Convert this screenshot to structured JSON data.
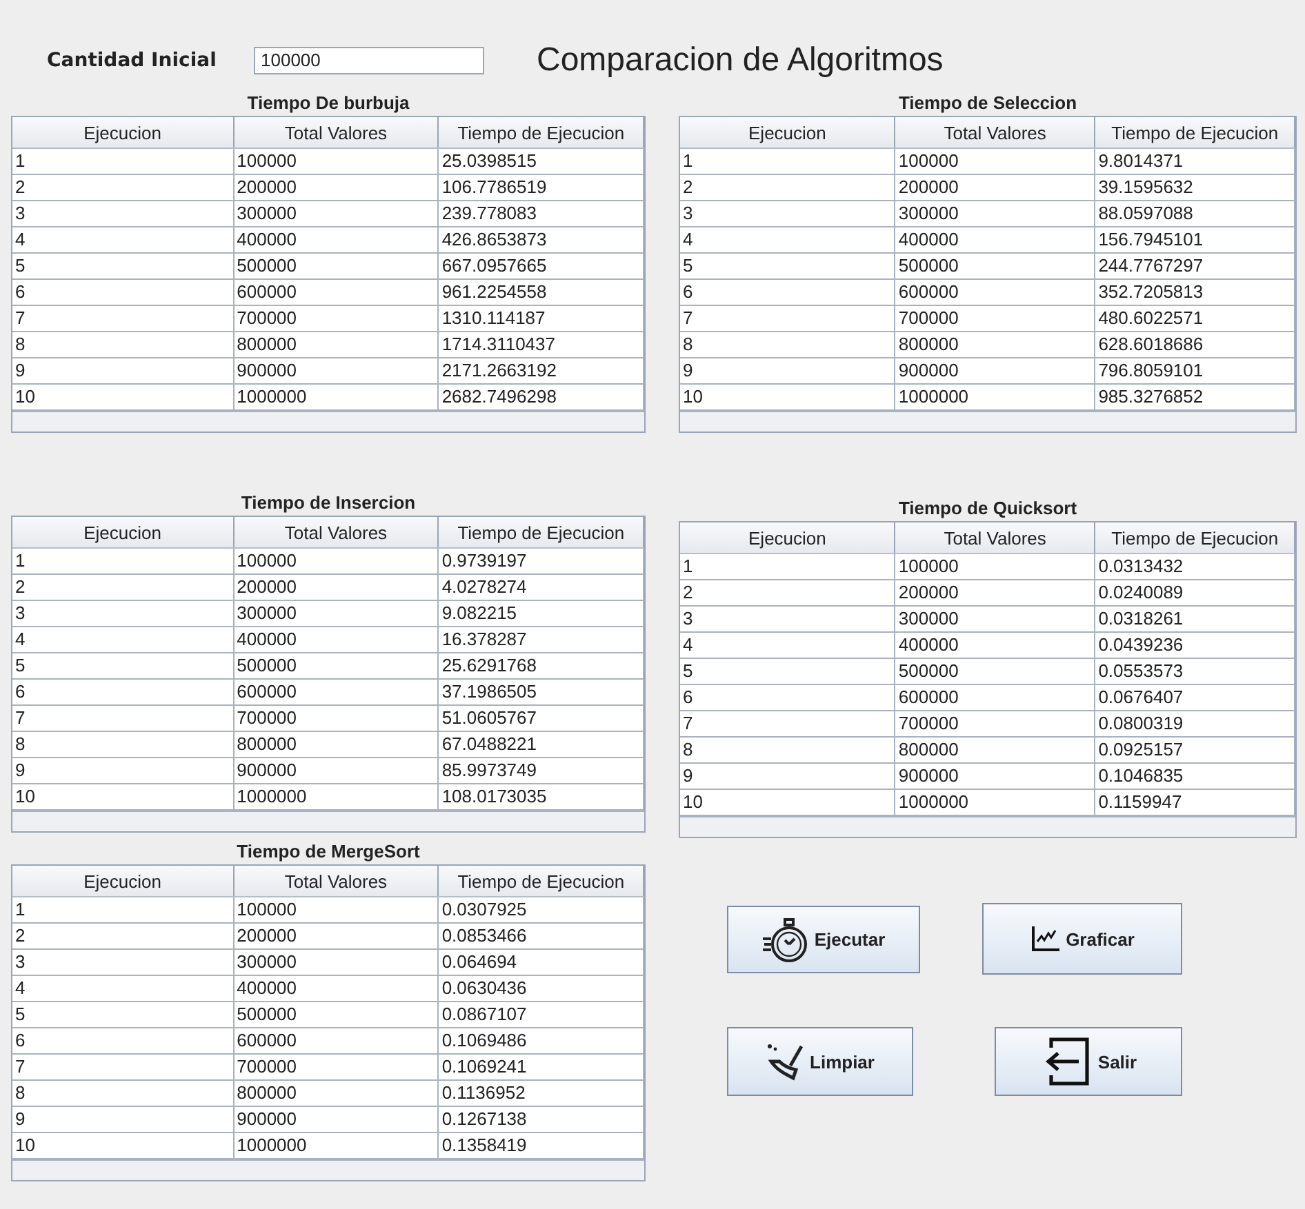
{
  "header": {
    "label": "Cantidad Inicial",
    "input_value": "100000",
    "title": "Comparacion de Algoritmos"
  },
  "tables": [
    {
      "title": "Tiempo De burbuja",
      "columns": [
        "Ejecucion",
        "Total Valores",
        "Tiempo de Ejecucion"
      ],
      "rows": [
        [
          "1",
          "100000",
          "25.0398515"
        ],
        [
          "2",
          "200000",
          "106.7786519"
        ],
        [
          "3",
          "300000",
          "239.778083"
        ],
        [
          "4",
          "400000",
          "426.8653873"
        ],
        [
          "5",
          "500000",
          "667.0957665"
        ],
        [
          "6",
          "600000",
          "961.2254558"
        ],
        [
          "7",
          "700000",
          "1310.114187"
        ],
        [
          "8",
          "800000",
          "1714.3110437"
        ],
        [
          "9",
          "900000",
          "2171.2663192"
        ],
        [
          "10",
          "1000000",
          "2682.7496298"
        ]
      ]
    },
    {
      "title": "Tiempo de Seleccion",
      "columns": [
        "Ejecucion",
        "Total Valores",
        "Tiempo de Ejecucion"
      ],
      "rows": [
        [
          "1",
          "100000",
          "9.8014371"
        ],
        [
          "2",
          "200000",
          "39.1595632"
        ],
        [
          "3",
          "300000",
          "88.0597088"
        ],
        [
          "4",
          "400000",
          "156.7945101"
        ],
        [
          "5",
          "500000",
          "244.7767297"
        ],
        [
          "6",
          "600000",
          "352.7205813"
        ],
        [
          "7",
          "700000",
          "480.6022571"
        ],
        [
          "8",
          "800000",
          "628.6018686"
        ],
        [
          "9",
          "900000",
          "796.8059101"
        ],
        [
          "10",
          "1000000",
          "985.3276852"
        ]
      ]
    },
    {
      "title": "Tiempo de Insercion",
      "columns": [
        "Ejecucion",
        "Total Valores",
        "Tiempo de Ejecucion"
      ],
      "rows": [
        [
          "1",
          "100000",
          "0.9739197"
        ],
        [
          "2",
          "200000",
          "4.0278274"
        ],
        [
          "3",
          "300000",
          "9.082215"
        ],
        [
          "4",
          "400000",
          "16.378287"
        ],
        [
          "5",
          "500000",
          "25.6291768"
        ],
        [
          "6",
          "600000",
          "37.1986505"
        ],
        [
          "7",
          "700000",
          "51.0605767"
        ],
        [
          "8",
          "800000",
          "67.0488221"
        ],
        [
          "9",
          "900000",
          "85.9973749"
        ],
        [
          "10",
          "1000000",
          "108.0173035"
        ]
      ]
    },
    {
      "title": "Tiempo de Quicksort",
      "columns": [
        "Ejecucion",
        "Total Valores",
        "Tiempo de Ejecucion"
      ],
      "rows": [
        [
          "1",
          "100000",
          "0.0313432"
        ],
        [
          "2",
          "200000",
          "0.0240089"
        ],
        [
          "3",
          "300000",
          "0.0318261"
        ],
        [
          "4",
          "400000",
          "0.0439236"
        ],
        [
          "5",
          "500000",
          "0.0553573"
        ],
        [
          "6",
          "600000",
          "0.0676407"
        ],
        [
          "7",
          "700000",
          "0.0800319"
        ],
        [
          "8",
          "800000",
          "0.0925157"
        ],
        [
          "9",
          "900000",
          "0.1046835"
        ],
        [
          "10",
          "1000000",
          "0.1159947"
        ]
      ]
    },
    {
      "title": "Tiempo de MergeSort",
      "columns": [
        "Ejecucion",
        "Total Valores",
        "Tiempo de Ejecucion"
      ],
      "rows": [
        [
          "1",
          "100000",
          "0.0307925"
        ],
        [
          "2",
          "200000",
          "0.0853466"
        ],
        [
          "3",
          "300000",
          "0.064694"
        ],
        [
          "4",
          "400000",
          "0.0630436"
        ],
        [
          "5",
          "500000",
          "0.0867107"
        ],
        [
          "6",
          "600000",
          "0.1069486"
        ],
        [
          "7",
          "700000",
          "0.1069241"
        ],
        [
          "8",
          "800000",
          "0.1136952"
        ],
        [
          "9",
          "900000",
          "0.1267138"
        ],
        [
          "10",
          "1000000",
          "0.1358419"
        ]
      ]
    }
  ],
  "buttons": [
    {
      "label": "Ejecutar",
      "kind": "stopwatch"
    },
    {
      "label": "Graficar",
      "kind": "chart"
    },
    {
      "label": "Limpiar",
      "kind": "broom"
    },
    {
      "label": "Salir",
      "kind": "exit"
    }
  ]
}
